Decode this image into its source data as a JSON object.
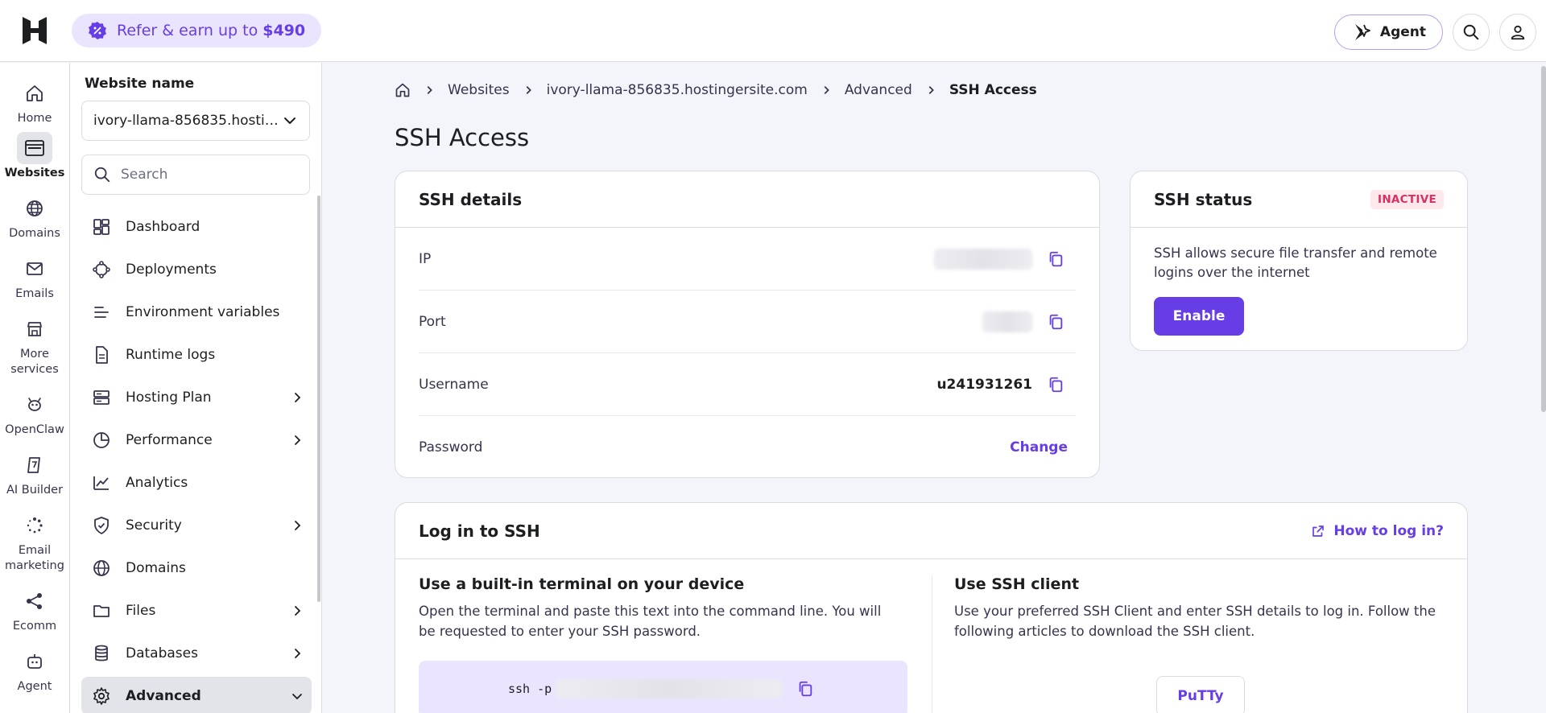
{
  "brand": {
    "accent": "#673de6",
    "logo_icon": "hostinger-logo"
  },
  "topbar": {
    "refer_text": "Refer & earn up to",
    "refer_amount": "$490",
    "agent_label": "Agent"
  },
  "rail": [
    {
      "label": "Home",
      "icon": "home-icon"
    },
    {
      "label": "Websites",
      "icon": "browser-icon",
      "active": true
    },
    {
      "label": "Domains",
      "icon": "globe-icon"
    },
    {
      "label": "Emails",
      "icon": "mail-icon"
    },
    {
      "label": "More services",
      "icon": "store-icon"
    },
    {
      "label": "OpenClaw",
      "icon": "bot-icon"
    },
    {
      "label": "AI Builder",
      "icon": "ai-builder-icon"
    },
    {
      "label": "Email marketing",
      "icon": "spinner-icon"
    },
    {
      "label": "Ecomm",
      "icon": "share-nodes-icon"
    },
    {
      "label": "Agent",
      "icon": "agent-bot-icon"
    }
  ],
  "sidebar": {
    "website_label": "Website name",
    "website_value": "ivory-llama-856835.hostingersite.com",
    "search_placeholder": "Search",
    "items": [
      {
        "label": "Dashboard",
        "icon": "dashboard-icon"
      },
      {
        "label": "Deployments",
        "icon": "deployments-icon"
      },
      {
        "label": "Environment variables",
        "icon": "lines-icon"
      },
      {
        "label": "Runtime logs",
        "icon": "document-icon"
      },
      {
        "label": "Hosting Plan",
        "icon": "server-icon",
        "chevron": "right"
      },
      {
        "label": "Performance",
        "icon": "pie-chart-icon",
        "chevron": "right"
      },
      {
        "label": "Analytics",
        "icon": "trend-icon"
      },
      {
        "label": "Security",
        "icon": "shield-icon",
        "chevron": "right"
      },
      {
        "label": "Domains",
        "icon": "globe-icon"
      },
      {
        "label": "Files",
        "icon": "folder-icon",
        "chevron": "right"
      },
      {
        "label": "Databases",
        "icon": "database-icon",
        "chevron": "right"
      },
      {
        "label": "Advanced",
        "icon": "gear-icon",
        "chevron": "down",
        "active": true
      }
    ]
  },
  "breadcrumb": [
    "Websites",
    "ivory-llama-856835.hostingersite.com",
    "Advanced",
    "SSH Access"
  ],
  "page_title": "SSH Access",
  "ssh_details": {
    "title": "SSH details",
    "rows": [
      {
        "label": "IP"
      },
      {
        "label": "Port"
      },
      {
        "label": "Username",
        "value": "u241931261"
      },
      {
        "label": "Password",
        "action": "Change"
      }
    ]
  },
  "ssh_status": {
    "title": "SSH status",
    "badge": "INACTIVE",
    "badge_color": "#d63163",
    "description": "SSH allows secure file transfer and remote logins over the internet",
    "enable_label": "Enable"
  },
  "login": {
    "title": "Log in to SSH",
    "help_link": "How to log in?",
    "terminal_title": "Use a built-in terminal on your device",
    "terminal_text": "Open the terminal and paste this text into the command line. You will be requested to enter your SSH password.",
    "command_prefix": "ssh -p",
    "client_title": "Use SSH client",
    "client_text": "Use your preferred SSH Client and enter SSH details to log in. Follow the following articles to download the SSH client.",
    "client_button": "PuTTy"
  }
}
